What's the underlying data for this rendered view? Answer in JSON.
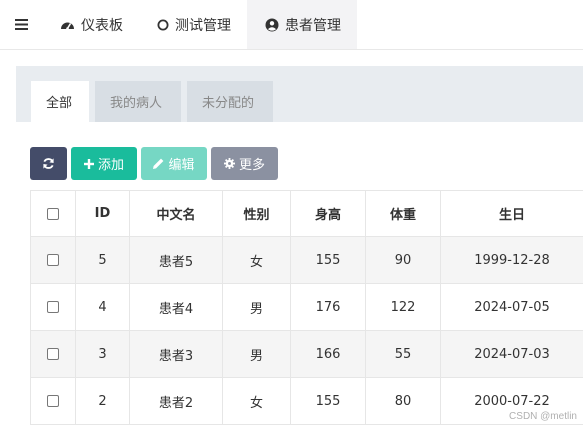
{
  "nav": {
    "items": [
      {
        "label": "仪表板",
        "icon": "dashboard-icon"
      },
      {
        "label": "测试管理",
        "icon": "circle-icon"
      },
      {
        "label": "患者管理",
        "icon": "user-circle-icon"
      }
    ],
    "active": 2
  },
  "tabs": [
    {
      "label": "全部"
    },
    {
      "label": "我的病人"
    },
    {
      "label": "未分配的"
    }
  ],
  "toolbar": {
    "add_label": "添加",
    "edit_label": "编辑",
    "more_label": "更多"
  },
  "table": {
    "columns": [
      "ID",
      "中文名",
      "性别",
      "身高",
      "体重",
      "生日"
    ],
    "rows": [
      {
        "id": "5",
        "name": "患者5",
        "gender": "女",
        "height": "155",
        "weight": "90",
        "birthday": "1999-12-28"
      },
      {
        "id": "4",
        "name": "患者4",
        "gender": "男",
        "height": "176",
        "weight": "122",
        "birthday": "2024-07-05"
      },
      {
        "id": "3",
        "name": "患者3",
        "gender": "男",
        "height": "166",
        "weight": "55",
        "birthday": "2024-07-03"
      },
      {
        "id": "2",
        "name": "患者2",
        "gender": "女",
        "height": "155",
        "weight": "80",
        "birthday": "2000-07-22"
      }
    ]
  },
  "watermark": "CSDN @metlin",
  "colors": {
    "primary_dark": "#444c69",
    "success": "#1abc9c",
    "success_light": "#76d7c4",
    "gray": "#8b91a1",
    "female_text": "#18bc9c"
  }
}
